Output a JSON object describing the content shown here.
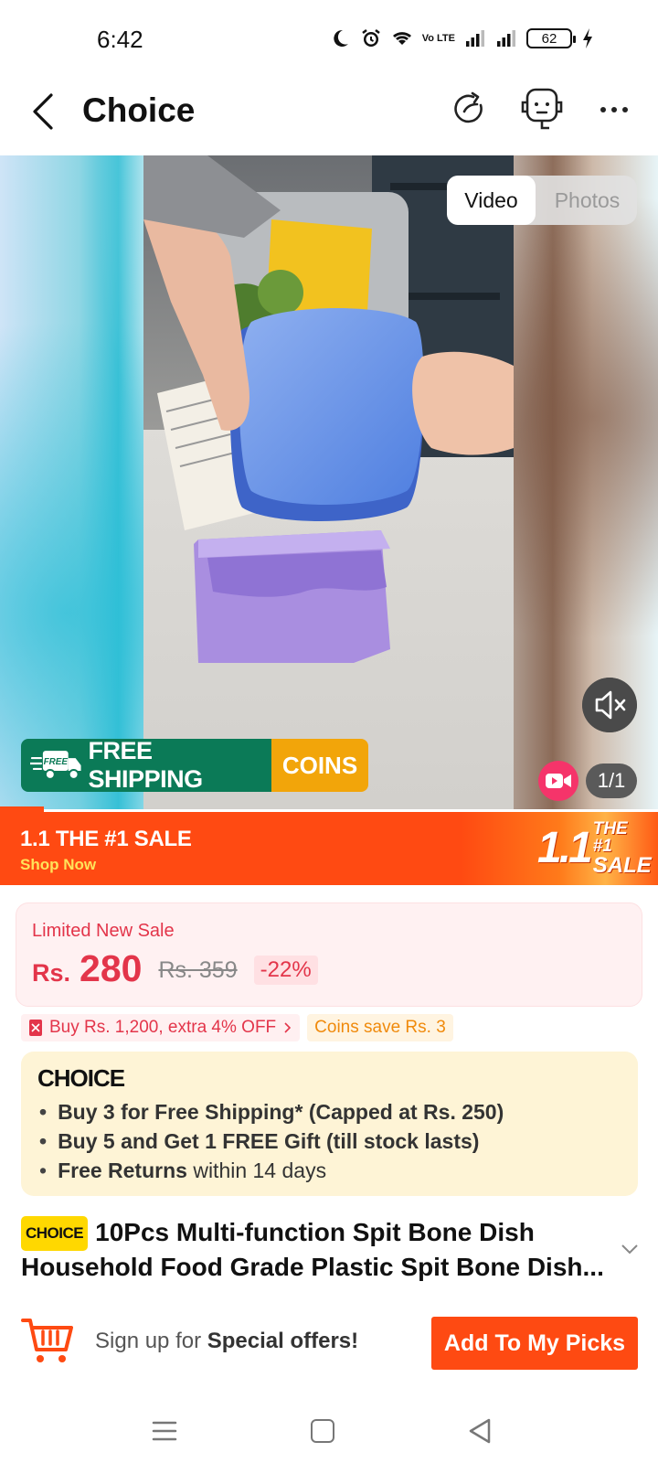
{
  "status_bar": {
    "time": "6:42",
    "network_label": "Vo LTE",
    "battery": "62"
  },
  "nav": {
    "title": "Choice"
  },
  "media": {
    "tab_video": "Video",
    "tab_photos": "Photos",
    "shipping_tag": "FREE",
    "shipping_label": "FREE SHIPPING",
    "coins_label": "COINS",
    "counter": "1/1"
  },
  "sale_banner": {
    "title": "1.1 THE #1 SALE",
    "cta": "Shop Now",
    "logo_big": "1.1",
    "logo_small_1": "THE #1",
    "logo_small_2": "SALE"
  },
  "price": {
    "label": "Limited New Sale",
    "currency": "Rs.",
    "value": "280",
    "original": "Rs. 359",
    "discount": "-22%"
  },
  "promos": {
    "offer": "Buy Rs. 1,200, extra 4% OFF",
    "coins": "Coins save Rs. 3"
  },
  "choice_box": {
    "logo": "CHOICE",
    "items": [
      {
        "text": "Buy 3 for  Free Shipping* (Capped at Rs. 250)"
      },
      {
        "text": "Buy 5 and Get 1 FREE Gift (till stock lasts)"
      },
      {
        "bold": "Free Returns",
        "rest": " within 14 days"
      }
    ]
  },
  "product": {
    "badge": "CHOICE",
    "title_line1": "10Pcs Multi-function Spit Bone Dish",
    "title_line2": "Household Food Grade Plastic Spit Bone Dish..."
  },
  "action_bar": {
    "signup_prefix": "Sign up for ",
    "signup_bold": "Special offers!",
    "button": "Add To My Picks"
  },
  "colors": {
    "accent": "#fe4a12",
    "price_red": "#e3354a",
    "shipping_green": "#0b7a57",
    "coins_gold": "#f2a50a",
    "choice_bg": "#fef4d6"
  }
}
